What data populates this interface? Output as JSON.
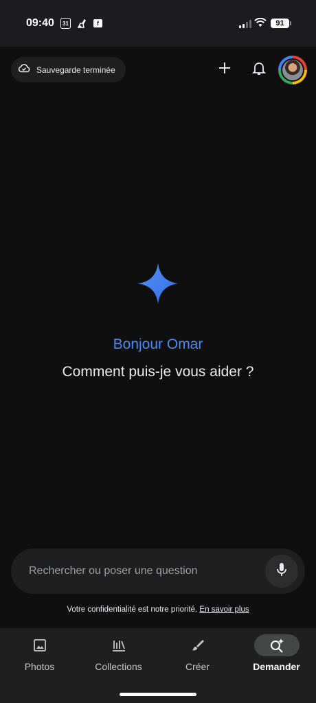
{
  "status_bar": {
    "time": "09:40",
    "calendar_day": "31",
    "battery_level": "91",
    "signal_bars": 2
  },
  "header": {
    "backup_status": "Sauvegarde terminée",
    "add_icon": "plus-icon",
    "notifications_icon": "bell-icon"
  },
  "assistant": {
    "icon": "gemini-sparkle-icon",
    "greeting": "Bonjour Omar",
    "question": "Comment puis-je vous aider ?",
    "accent_color": "#4a8af4"
  },
  "search": {
    "placeholder": "Rechercher ou poser une question",
    "value": "",
    "mic_icon": "microphone-icon"
  },
  "privacy": {
    "text": "Votre confidentialité est notre priorité.",
    "link": "En savoir plus"
  },
  "bottom_nav": {
    "items": [
      {
        "label": "Photos",
        "icon": "photo-icon",
        "active": false
      },
      {
        "label": "Collections",
        "icon": "collections-icon",
        "active": false
      },
      {
        "label": "Créer",
        "icon": "brush-icon",
        "active": false
      },
      {
        "label": "Demander",
        "icon": "ask-sparkle-search-icon",
        "active": true
      }
    ]
  },
  "colors": {
    "background": "#0f0f0f",
    "surface": "#1f1f1f",
    "active_pill": "#444746"
  }
}
